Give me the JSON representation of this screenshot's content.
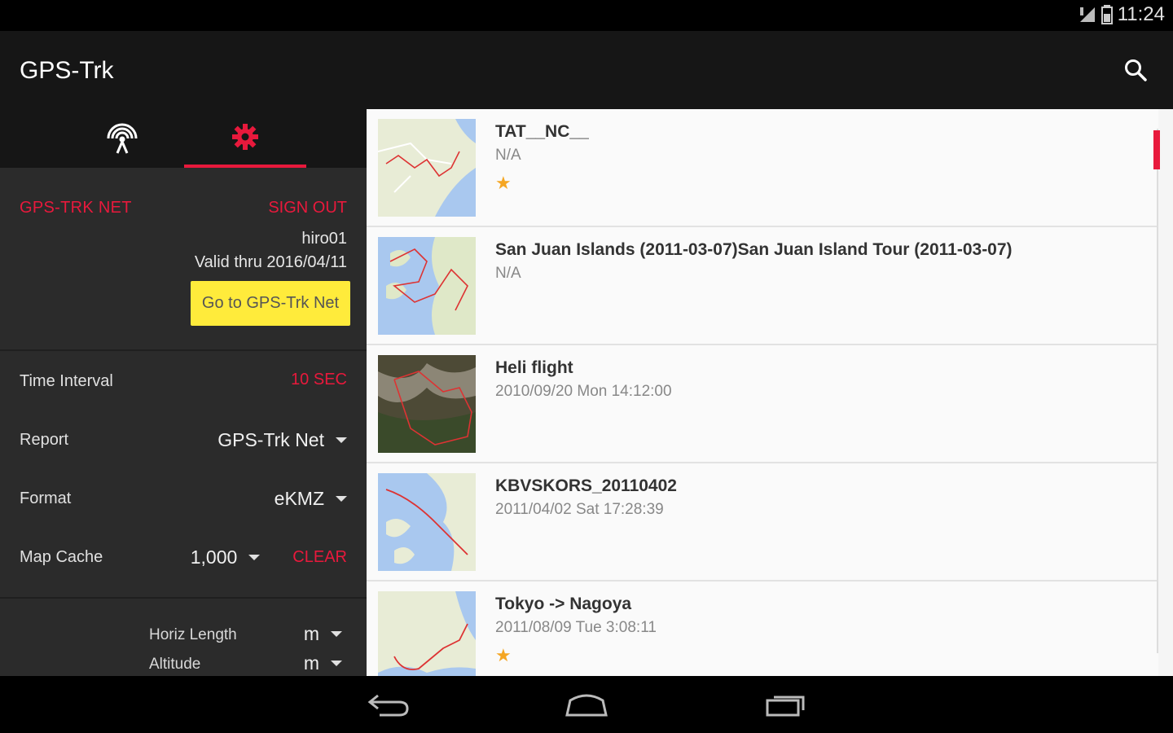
{
  "status": {
    "time": "11:24"
  },
  "appbar": {
    "title": "GPS-Trk"
  },
  "tabs": [
    {
      "name": "antenna-icon",
      "selected": false
    },
    {
      "name": "gear-icon",
      "selected": true
    }
  ],
  "account": {
    "service": "GPS-TRK NET",
    "sign_out": "SIGN OUT",
    "user": "hiro01",
    "valid": "Valid thru 2016/04/11",
    "go_button": "Go to GPS-Trk Net"
  },
  "settings": {
    "time_interval": {
      "label": "Time Interval",
      "value": "10 SEC"
    },
    "report": {
      "label": "Report",
      "value": "GPS-Trk Net"
    },
    "format": {
      "label": "Format",
      "value": "eKMZ"
    },
    "map_cache": {
      "label": "Map Cache",
      "value": "1,000",
      "clear": "CLEAR"
    },
    "horiz_length": {
      "label": "Horiz Length",
      "value": "m"
    },
    "altitude": {
      "label": "Altitude",
      "value": "m"
    }
  },
  "tracks": [
    {
      "title": "TAT__NC__",
      "subtitle": "N/A",
      "starred": true,
      "star": "★"
    },
    {
      "title": "San Juan Islands (2011-03-07)San Juan Island Tour (2011-03-07)",
      "subtitle": "N/A",
      "starred": false
    },
    {
      "title": "Heli flight",
      "subtitle": "2010/09/20 Mon  14:12:00",
      "starred": false
    },
    {
      "title": "KBVSKORS_20110402",
      "subtitle": "2011/04/02 Sat  17:28:39",
      "starred": false
    },
    {
      "title": "Tokyo -> Nagoya",
      "subtitle": "2011/08/09 Tue  3:08:11",
      "starred": true,
      "star": "★"
    }
  ],
  "colors": {
    "accent": "#e8193c",
    "button": "#ffeb3b",
    "star": "#f5a623"
  }
}
